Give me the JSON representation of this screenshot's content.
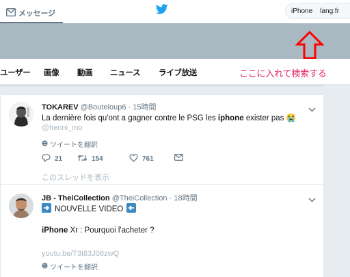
{
  "header": {
    "messages_label": "メッセージ",
    "search_value": "iPhone    lang:fr"
  },
  "nav": {
    "items": [
      "ユーザー",
      "画像",
      "動画",
      "ニュース",
      "ライブ放送"
    ]
  },
  "annotation": "ここに入れて検索する",
  "colors": {
    "twitter_blue": "#1da1f2",
    "annotation_red": "#e0245e",
    "arrow_red": "#ff0000"
  },
  "tweets": [
    {
      "name": "TOKAREV",
      "handle": "@Bouteloup6",
      "separator": "·",
      "time": "15時間",
      "text_before": "La dernière fois qu'ont a gagner contre le PSG les ",
      "text_bold": "iphone",
      "text_after": " exister pas 😭",
      "mention": "@henni_mo",
      "translate": "ツイートを翻訳",
      "replies": "21",
      "retweets": "154",
      "likes": "761",
      "thread": "このスレッドを表示"
    },
    {
      "name": "JB - TheiCollection",
      "handle": "@TheiCollection",
      "separator": "·",
      "time": "18時間",
      "headline": "NOUVELLE VIDEO",
      "line_bold": "iPhone",
      "line_rest": " Xr : Pourquoi l'acheter ?",
      "link": "youtu.be/T3t83J08zwQ",
      "translate": "ツイートを翻訳"
    }
  ]
}
